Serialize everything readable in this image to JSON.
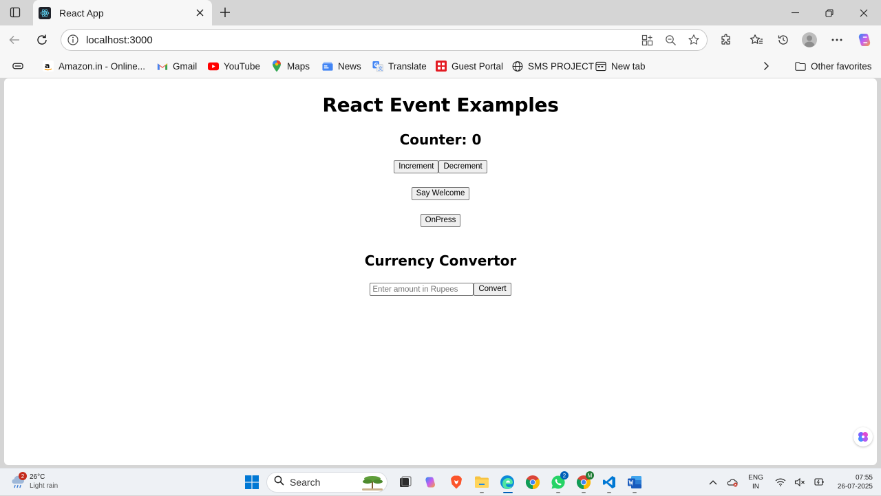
{
  "browser": {
    "tab": {
      "title": "React App"
    },
    "address": {
      "url": "localhost:3000"
    },
    "favorites": [
      {
        "label": "Amazon.in - Online...",
        "icon": "amazon-icon"
      },
      {
        "label": "Gmail",
        "icon": "gmail-icon"
      },
      {
        "label": "YouTube",
        "icon": "youtube-icon"
      },
      {
        "label": "Maps",
        "icon": "maps-icon"
      },
      {
        "label": "News",
        "icon": "news-icon"
      },
      {
        "label": "Translate",
        "icon": "translate-icon"
      },
      {
        "label": "Guest Portal",
        "icon": "guest-portal-icon"
      },
      {
        "label": "SMS PROJECT",
        "icon": "globe-icon"
      },
      {
        "label": "New tab",
        "icon": "new-tab-icon"
      }
    ],
    "other_favorites": "Other favorites"
  },
  "page": {
    "title": "React Event Examples",
    "counter_label": "Counter: 0",
    "increment_button": "Increment",
    "decrement_button": "Decrement",
    "welcome_button": "Say Welcome",
    "onpress_button": "OnPress",
    "currency_title": "Currency Convertor",
    "amount_placeholder": "Enter amount in Rupees",
    "convert_button": "Convert"
  },
  "taskbar": {
    "weather": {
      "badge": "2",
      "temp": "26°C",
      "condition": "Light rain"
    },
    "search_label": "Search",
    "whatsapp_badge": "2",
    "chrome_badge": "M",
    "lang_line1": "ENG",
    "lang_line2": "IN",
    "time": "07:55",
    "date": "26-07-2025"
  },
  "colors": {
    "accent": "#005fb8",
    "youtube_red": "#ff0000",
    "badge_red": "#c42b1c",
    "whatsapp_green": "#25d366"
  }
}
